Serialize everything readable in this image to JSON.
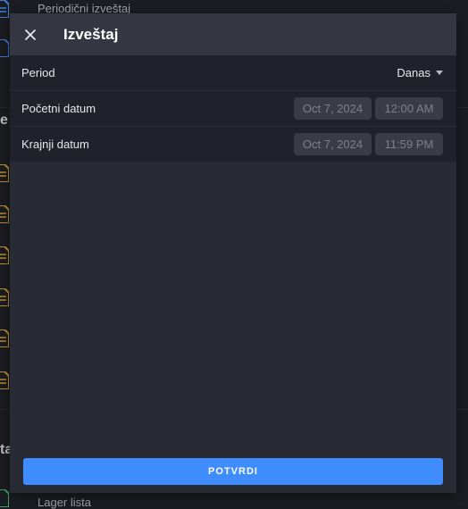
{
  "background": {
    "top_item_label": "Periodični izveštaj",
    "bottom_item_label": "Lager lista",
    "section_letter_1": "e",
    "section_letter_2": "ta"
  },
  "modal": {
    "title": "Izveštaj",
    "close_icon": "close-icon",
    "period": {
      "label": "Period",
      "value": "Danas"
    },
    "start": {
      "label": "Početni datum",
      "date": "Oct 7, 2024",
      "time": "12:00 AM"
    },
    "end": {
      "label": "Krajnji datum",
      "date": "Oct 7, 2024",
      "time": "11:59 PM"
    },
    "confirm_label": "POTVRDI"
  },
  "colors": {
    "accent": "#3f8cff",
    "modal_bg": "#282a34",
    "header_bg": "#343642",
    "doc_icon_blue": "#3f7fdc",
    "doc_icon_yellow": "#c99a2e",
    "doc_icon_green": "#3fa86b"
  }
}
